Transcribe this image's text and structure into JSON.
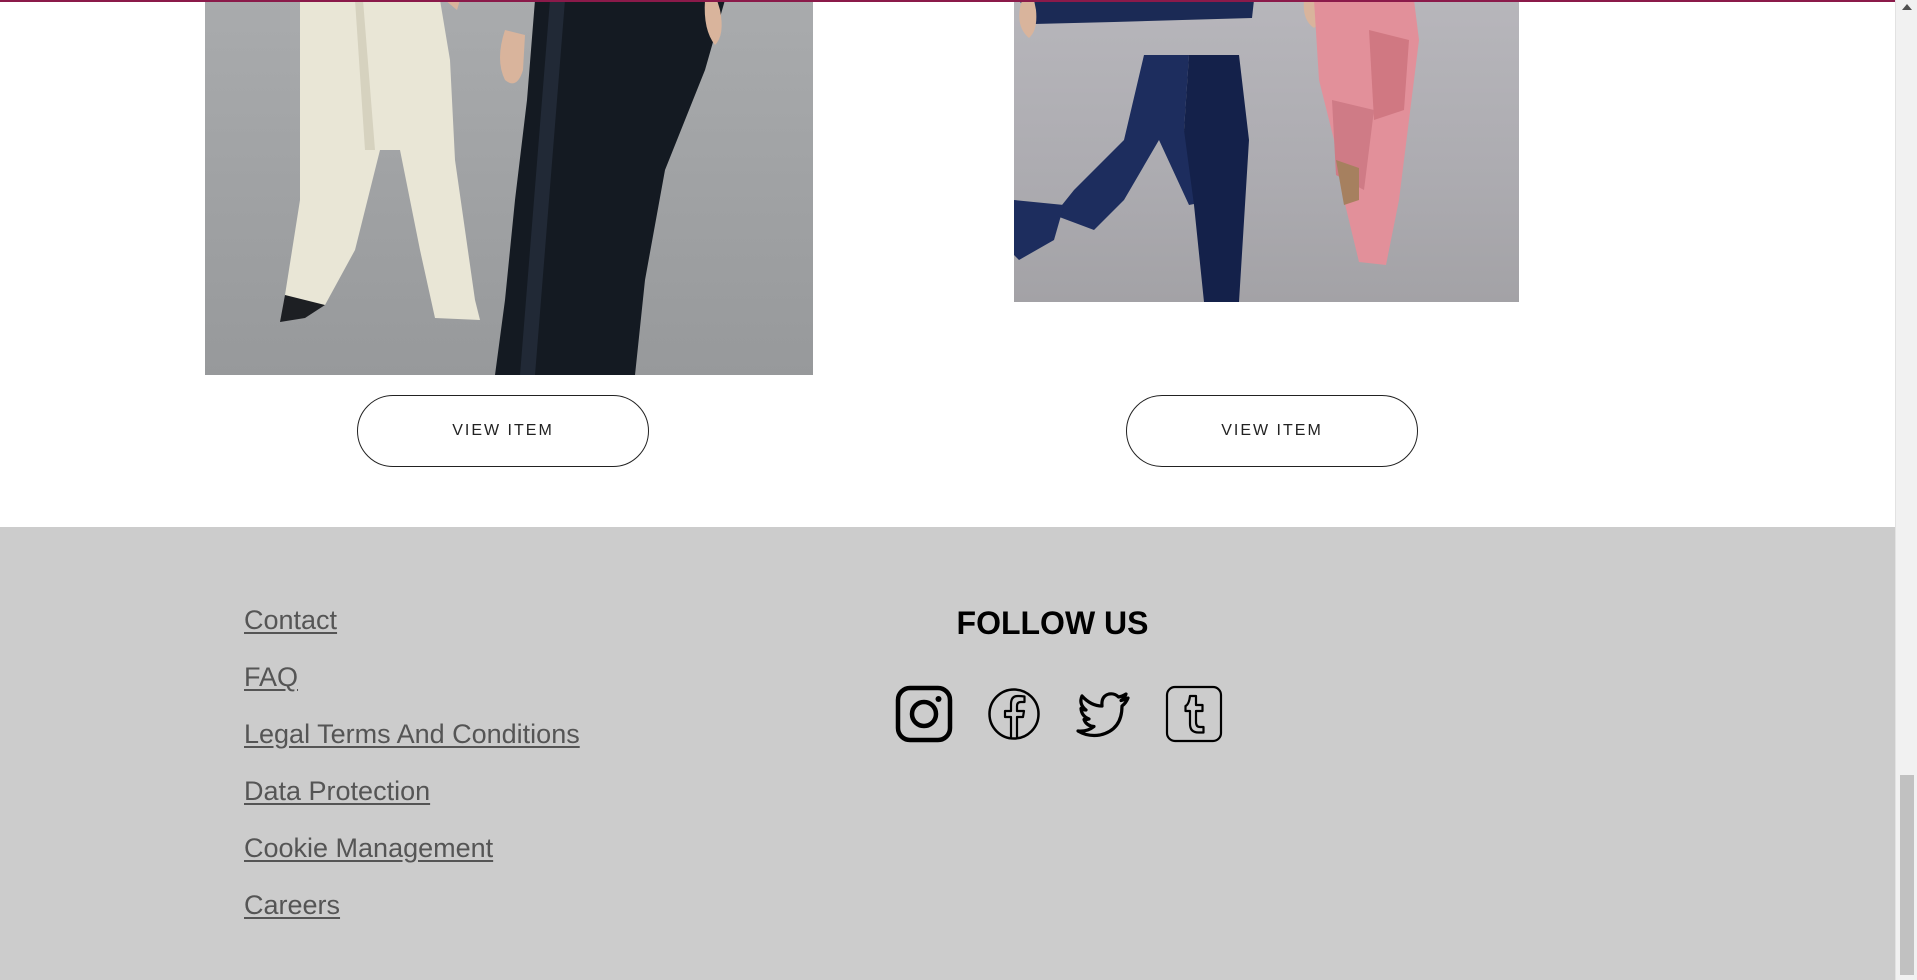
{
  "products": [
    {
      "button_label": "VIEW ITEM"
    },
    {
      "button_label": "VIEW ITEM"
    }
  ],
  "footer": {
    "links": [
      "Contact",
      "FAQ",
      "Legal Terms And Conditions",
      "Data Protection",
      "Cookie Management",
      "Careers"
    ],
    "follow_title": "FOLLOW US",
    "social_icons": [
      "instagram-icon",
      "facebook-icon",
      "twitter-icon",
      "tumblr-icon"
    ]
  },
  "colors": {
    "accent": "#8b1a4a",
    "footer_background": "#cccccc",
    "link_text": "#555555"
  }
}
